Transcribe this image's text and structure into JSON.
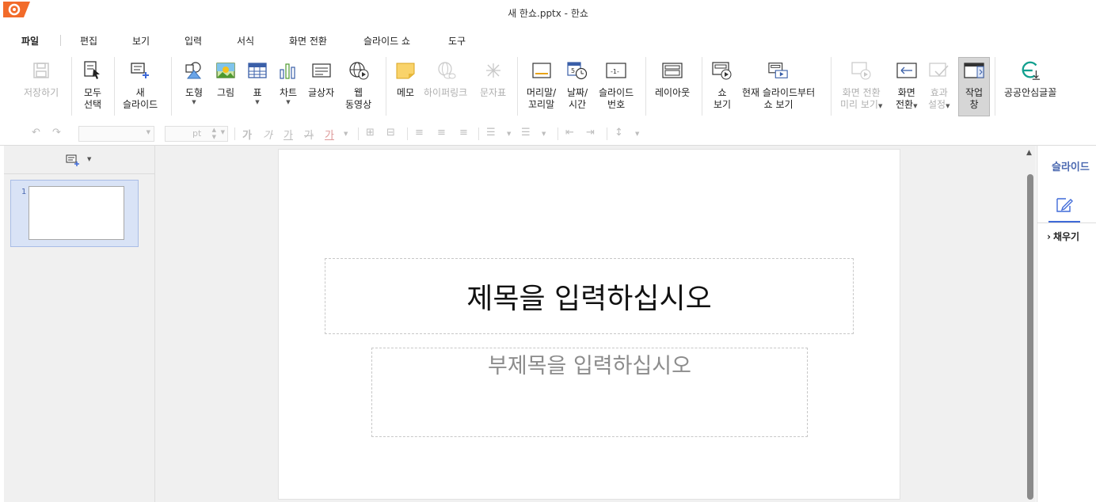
{
  "window": {
    "title": "새 한쇼.pptx - 한쇼"
  },
  "menu": {
    "tabs": [
      "파일",
      "편집",
      "보기",
      "입력",
      "서식",
      "화면 전환",
      "슬라이드 쇼",
      "도구"
    ]
  },
  "ribbon": {
    "save": {
      "line1": "저장하기"
    },
    "select_all": {
      "line1": "모두",
      "line2": "선택"
    },
    "new_slide": {
      "line1": "새",
      "line2": "슬라이드"
    },
    "shape": {
      "line1": "도형"
    },
    "picture": {
      "line1": "그림"
    },
    "table": {
      "line1": "표"
    },
    "chart": {
      "line1": "차트"
    },
    "textbox": {
      "line1": "글상자"
    },
    "web_video": {
      "line1": "웹",
      "line2": "동영상"
    },
    "memo": {
      "line1": "메모"
    },
    "hyperlink": {
      "line1": "하이퍼링크"
    },
    "symbol": {
      "line1": "문자표"
    },
    "header_footer": {
      "line1": "머리말/",
      "line2": "꼬리말"
    },
    "date_time": {
      "line1": "날짜/",
      "line2": "시간"
    },
    "slide_number": {
      "line1": "슬라이드",
      "line2": "번호"
    },
    "layout": {
      "line1": "레이아웃"
    },
    "show": {
      "line1": "쇼",
      "line2": "보기"
    },
    "show_from_current": {
      "line1": "현재 슬라이드부터",
      "line2": "쇼 보기"
    },
    "transition_preview": {
      "line1": "화면 전환",
      "line2": "미리 보기"
    },
    "transition": {
      "line1": "화면",
      "line2": "전환"
    },
    "effect_settings": {
      "line1": "효과",
      "line2": "설정"
    },
    "task_pane": {
      "line1": "작업",
      "line2": "창"
    },
    "public_font": {
      "line1": "공공안심글꼴"
    }
  },
  "format_bar": {
    "font_size_unit": "pt",
    "char_glyph": "가"
  },
  "slides": [
    {
      "number": "1"
    }
  ],
  "slide": {
    "title_placeholder": "제목을 입력하십시오",
    "subtitle_placeholder": "부제목을 입력하십시오"
  },
  "right_panel": {
    "title": "슬라이드",
    "fill_section": "채우기"
  },
  "colors": {
    "accent": "#3f6ad8",
    "logo": "#f26b2a",
    "panel_bg": "#f0f0f0",
    "thumb_selected": "#d9e3f6"
  }
}
